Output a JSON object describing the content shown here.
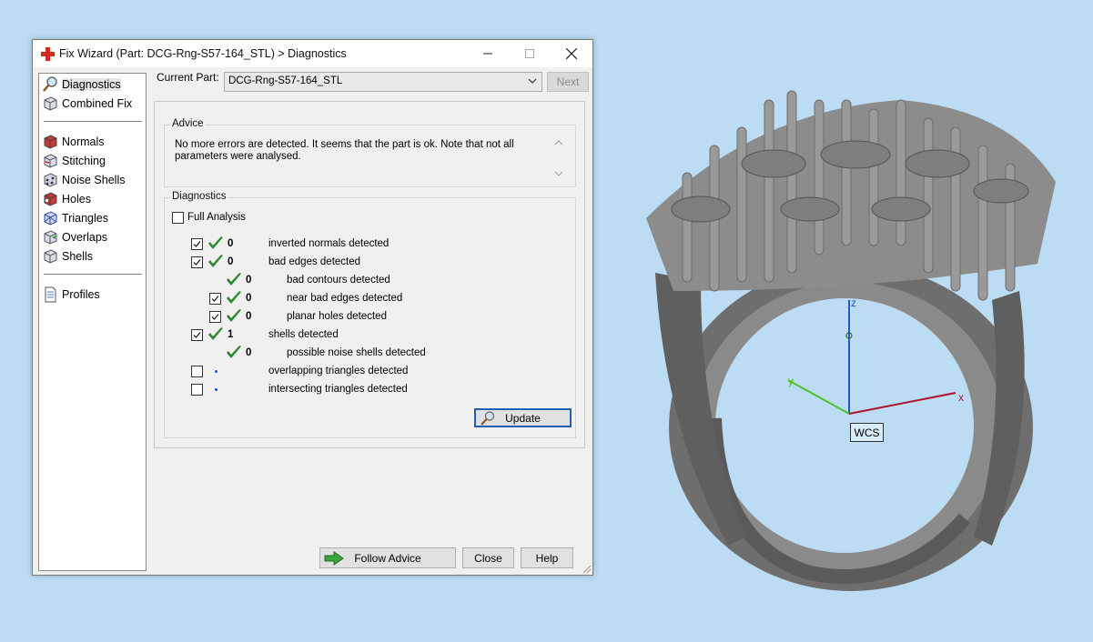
{
  "window": {
    "title": "Fix Wizard (Part: DCG-Rng-S57-164_STL) > Diagnostics",
    "controls": {
      "minimize": "minimize",
      "maximize": "maximize",
      "close": "close"
    }
  },
  "sidebar": {
    "items": [
      {
        "label": "Diagnostics",
        "icon": "magnifier-icon",
        "selected": true
      },
      {
        "label": "Combined Fix",
        "icon": "cube-icon"
      },
      {
        "label": "Normals",
        "icon": "red-cube-icon"
      },
      {
        "label": "Stitching",
        "icon": "stitch-cube-icon"
      },
      {
        "label": "Noise Shells",
        "icon": "dots-cube-icon"
      },
      {
        "label": "Holes",
        "icon": "holes-cube-icon"
      },
      {
        "label": "Triangles",
        "icon": "triangles-cube-icon"
      },
      {
        "label": "Overlaps",
        "icon": "overlaps-cube-icon"
      },
      {
        "label": "Shells",
        "icon": "shells-cube-icon"
      },
      {
        "label": "Profiles",
        "icon": "document-icon"
      }
    ]
  },
  "current_part": {
    "label": "Current Part:",
    "value": "DCG-Rng-S57-164_STL",
    "next_label": "Next"
  },
  "advice": {
    "title": "Advice",
    "text": "No more errors are detected. It seems that the part is ok. Note that not all parameters were analysed."
  },
  "diagnostics": {
    "title": "Diagnostics",
    "full_analysis_label": "Full Analysis",
    "full_analysis_checked": false,
    "rows": [
      {
        "checked": true,
        "status": "ok",
        "count": "0",
        "label": "inverted normals detected",
        "indent": 0
      },
      {
        "checked": true,
        "status": "ok",
        "count": "0",
        "label": "bad edges detected",
        "indent": 0
      },
      {
        "checked": null,
        "status": "ok",
        "count": "0",
        "label": "bad contours detected",
        "indent": 1
      },
      {
        "checked": true,
        "status": "ok",
        "count": "0",
        "label": "near bad edges detected",
        "indent": 1
      },
      {
        "checked": true,
        "status": "ok",
        "count": "0",
        "label": "planar holes detected",
        "indent": 1
      },
      {
        "checked": true,
        "status": "ok",
        "count": "1",
        "label": "shells detected",
        "indent": 0
      },
      {
        "checked": null,
        "status": "ok",
        "count": "0",
        "label": "possible noise shells detected",
        "indent": 1
      },
      {
        "checked": false,
        "status": "pending",
        "count": "",
        "label": "overlapping triangles detected",
        "indent": 0
      },
      {
        "checked": false,
        "status": "pending",
        "count": "",
        "label": "intersecting triangles detected",
        "indent": 0
      }
    ],
    "update_label": "Update"
  },
  "footer": {
    "follow_advice_label": "Follow Advice",
    "close_label": "Close",
    "help_label": "Help"
  },
  "viewport": {
    "axes": {
      "z": "z",
      "y": "y",
      "x": "x"
    },
    "wcs_label": "WCS",
    "colors": {
      "background": "#bcdcf3",
      "model": "#7a7a7a",
      "x_axis": "#b0142a",
      "y_axis": "#4cc22c",
      "z_axis": "#2457c9"
    }
  },
  "colors": {
    "check_green": "#2f8a2f",
    "pending_blue": "#1e4fd0",
    "focus_blue": "#1f5fb5"
  }
}
